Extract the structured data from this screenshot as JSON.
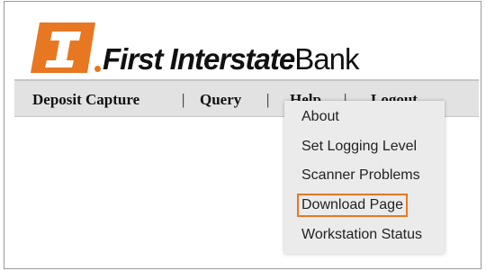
{
  "brand": {
    "name_bold": "First Interstate",
    "name_light": "Bank",
    "colors": {
      "orange": "#e87722",
      "text": "#111111"
    }
  },
  "nav": {
    "items": [
      {
        "label": "Deposit Capture"
      },
      {
        "label": "Query"
      },
      {
        "label": "Help"
      },
      {
        "label": "Logout"
      }
    ],
    "separator": "|"
  },
  "help_menu": {
    "items": [
      {
        "label": "About"
      },
      {
        "label": "Set Logging Level"
      },
      {
        "label": "Scanner Problems"
      },
      {
        "label": "Download Page",
        "highlighted": true
      },
      {
        "label": "Workstation Status"
      }
    ],
    "highlight_color": "#e87722"
  }
}
